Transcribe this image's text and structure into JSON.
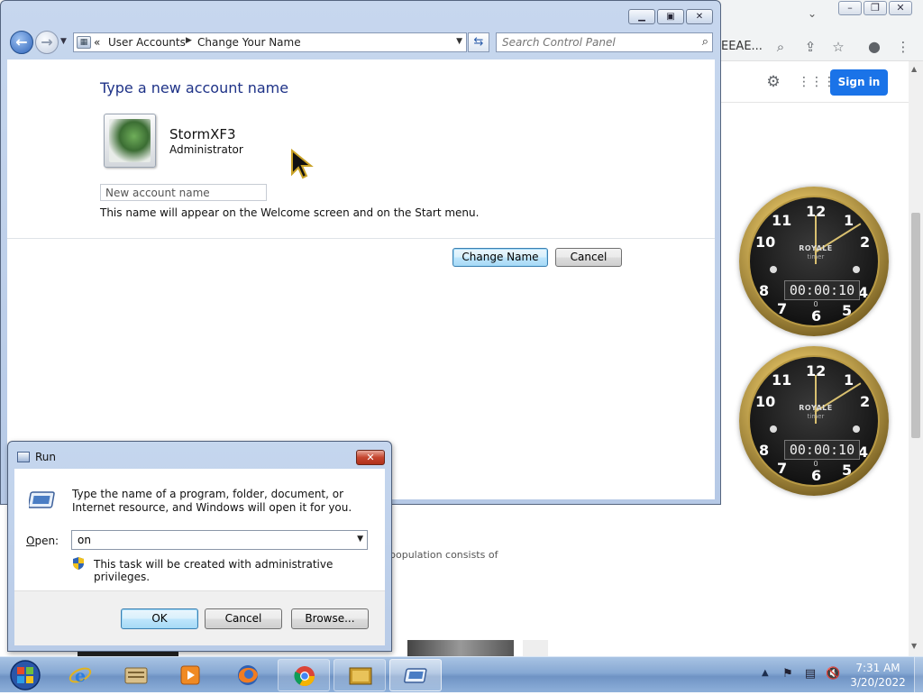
{
  "browser": {
    "omnibox_tail": "EEAE...",
    "sign_in_label": "Sign in",
    "page_snippet": "population consists of",
    "icons": [
      "zoom-icon",
      "share-icon",
      "bookmark-star-icon",
      "profile-icon",
      "menu-dots-icon",
      "settings-gear-icon",
      "apps-grid-icon"
    ]
  },
  "gadgets": {
    "clocks": [
      {
        "brand": "ROYALE",
        "sub": "timer",
        "readout": "00:00:10",
        "small": "0"
      },
      {
        "brand": "ROYALE",
        "sub": "timer",
        "readout": "00:00:10",
        "small": "0"
      }
    ],
    "numerals": [
      "12",
      "1",
      "2",
      "4",
      "5",
      "6",
      "7",
      "8",
      "10",
      "11"
    ]
  },
  "control_panel": {
    "breadcrumb": {
      "overflow": "«",
      "items": [
        "User Accounts",
        "Change Your Name"
      ]
    },
    "search_placeholder": "Search Control Panel",
    "heading": "Type a new account name",
    "account": {
      "name": "StormXF3",
      "role": "Administrator"
    },
    "new_name_placeholder": "New account name",
    "hint": "This name will appear on the Welcome screen and on the Start menu.",
    "buttons": {
      "change_name": "Change Name",
      "cancel": "Cancel"
    }
  },
  "run_dialog": {
    "title": "Run",
    "description": "Type the name of a program, folder, document, or Internet resource, and Windows will open it for you.",
    "open_label_prefix": "O",
    "open_label_rest": "pen:",
    "open_value": "on",
    "admin_note": "This task will be created with administrative privileges.",
    "buttons": {
      "ok": "OK",
      "cancel": "Cancel",
      "browse": "Browse..."
    }
  },
  "taskbar": {
    "items": [
      "internet-explorer",
      "file-explorer",
      "media-player",
      "firefox",
      "chrome",
      "app-gold",
      "run-dialog"
    ],
    "time": "7:31 AM",
    "date": "3/20/2022"
  },
  "colors": {
    "heading_blue": "#1e3287",
    "chrome_signin": "#1a73e8",
    "taskbar": "#86a8d3"
  }
}
